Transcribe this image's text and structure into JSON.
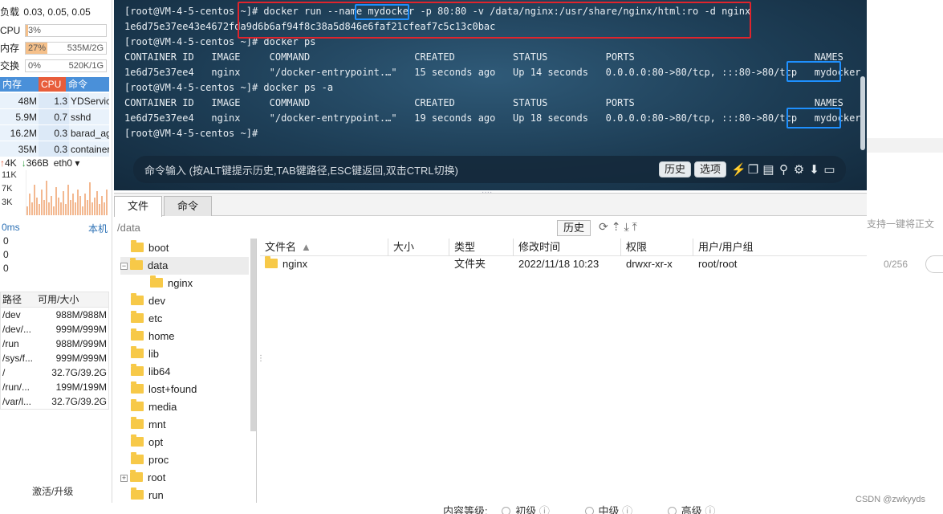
{
  "monitor": {
    "load_label": "负载",
    "load_value": "0.03, 0.05, 0.05",
    "cpu": {
      "label": "CPU",
      "pct": "3%",
      "fraction": 0.03
    },
    "mem": {
      "label": "内存",
      "pct": "27%",
      "size": "535M/2G",
      "fraction": 0.27
    },
    "swap": {
      "label": "交换",
      "pct": "0%",
      "size": "520K/1G",
      "fraction": 0.0
    },
    "proc_headers": [
      "内存",
      "CPU",
      "命令"
    ],
    "processes": [
      {
        "mem": "48M",
        "cpu": "1.3",
        "cmd": "YDService"
      },
      {
        "mem": "5.9M",
        "cpu": "0.7",
        "cmd": "sshd"
      },
      {
        "mem": "16.2M",
        "cpu": "0.3",
        "cmd": "barad_agent"
      },
      {
        "mem": "35M",
        "cpu": "0.3",
        "cmd": "containerd"
      }
    ],
    "net_up": "4K",
    "net_down": "366B",
    "net_iface": "eth0",
    "net_ticks": [
      "11K",
      "7K",
      "3K"
    ],
    "net_bars": [
      0.2,
      0.5,
      0.3,
      0.7,
      0.4,
      0.25,
      0.6,
      0.35,
      0.8,
      0.3,
      0.45,
      0.2,
      0.65,
      0.4,
      0.3,
      0.55,
      0.25,
      0.7,
      0.35,
      0.5,
      0.3,
      0.6,
      0.45,
      0.2,
      0.5,
      0.35,
      0.75,
      0.3,
      0.4,
      0.55,
      0.25,
      0.45,
      0.3,
      0.6
    ],
    "latency_label": "0ms",
    "latency_host": "本机",
    "latency_values": [
      "0",
      "0",
      "0"
    ],
    "disk_headers": [
      "路径",
      "可用/大小"
    ],
    "disks": [
      {
        "path": "/dev",
        "size": "988M/988M"
      },
      {
        "path": "/dev/...",
        "size": "999M/999M"
      },
      {
        "path": "/run",
        "size": "988M/999M"
      },
      {
        "path": "/sys/f...",
        "size": "999M/999M"
      },
      {
        "path": "/",
        "size": "32.7G/39.2G"
      },
      {
        "path": "/run/...",
        "size": "199M/199M"
      },
      {
        "path": "/var/l...",
        "size": "32.7G/39.2G"
      }
    ],
    "activate": "激活/升级"
  },
  "terminal": {
    "lines": [
      "[root@VM-4-5-centos ~]# docker run --name mydocker -p 80:80 -v /data/nginx:/usr/share/nginx/html:ro -d nginx",
      "1e6d75e37ee43e4672fda9d6b6af94f8c38a5d846e6faf21cfeaf7c5c13c0bac",
      "[root@VM-4-5-centos ~]# docker ps",
      "CONTAINER ID   IMAGE     COMMAND                  CREATED          STATUS          PORTS                               NAMES",
      "1e6d75e37ee4   nginx     \"/docker-entrypoint.…\"   15 seconds ago   Up 14 seconds   0.0.0.0:80->80/tcp, :::80->80/tcp   mydocker",
      "[root@VM-4-5-centos ~]# docker ps -a",
      "CONTAINER ID   IMAGE     COMMAND                  CREATED          STATUS          PORTS                               NAMES",
      "1e6d75e37ee4   nginx     \"/docker-entrypoint.…\"   19 seconds ago   Up 18 seconds   0.0.0.0:80->80/tcp, :::80->80/tcp   mydocker",
      "[root@VM-4-5-centos ~]# "
    ],
    "cmd_placeholder": "命令输入 (按ALT键提示历史,TAB键路径,ESC键返回,双击CTRL切换)",
    "history_btn": "历史",
    "options_btn": "选项"
  },
  "files": {
    "tabs": [
      "文件",
      "命令"
    ],
    "path": "/data",
    "history_btn": "历史",
    "tree": [
      {
        "name": "boot",
        "level": 0,
        "toggle": ""
      },
      {
        "name": "data",
        "level": 0,
        "toggle": "−"
      },
      {
        "name": "nginx",
        "level": 1,
        "toggle": ""
      },
      {
        "name": "dev",
        "level": 0,
        "toggle": ""
      },
      {
        "name": "etc",
        "level": 0,
        "toggle": ""
      },
      {
        "name": "home",
        "level": 0,
        "toggle": ""
      },
      {
        "name": "lib",
        "level": 0,
        "toggle": ""
      },
      {
        "name": "lib64",
        "level": 0,
        "toggle": ""
      },
      {
        "name": "lost+found",
        "level": 0,
        "toggle": ""
      },
      {
        "name": "media",
        "level": 0,
        "toggle": ""
      },
      {
        "name": "mnt",
        "level": 0,
        "toggle": ""
      },
      {
        "name": "opt",
        "level": 0,
        "toggle": ""
      },
      {
        "name": "proc",
        "level": 0,
        "toggle": ""
      },
      {
        "name": "root",
        "level": 0,
        "toggle": "+"
      },
      {
        "name": "run",
        "level": 0,
        "toggle": ""
      }
    ],
    "columns": [
      "文件名",
      "大小",
      "类型",
      "修改时间",
      "权限",
      "用户/用户组"
    ],
    "rows": [
      {
        "name": "nginx",
        "size": "",
        "type": "文件夹",
        "mtime": "2022/11/18 10:23",
        "perm": "drwxr-xr-x",
        "owner": "root/root"
      }
    ]
  },
  "background": {
    "hint": "支持一键将正文",
    "count": "0/256",
    "level_label": "内容等级:",
    "levels": [
      "初级",
      "中级",
      "高级"
    ],
    "watermark": "CSDN @zwkyyds"
  },
  "colors": {
    "red_box": "#e0242c",
    "blue_box": "#1e90ff",
    "proc_header": "#4a90d9",
    "proc_header_active": "#e85d3b"
  }
}
